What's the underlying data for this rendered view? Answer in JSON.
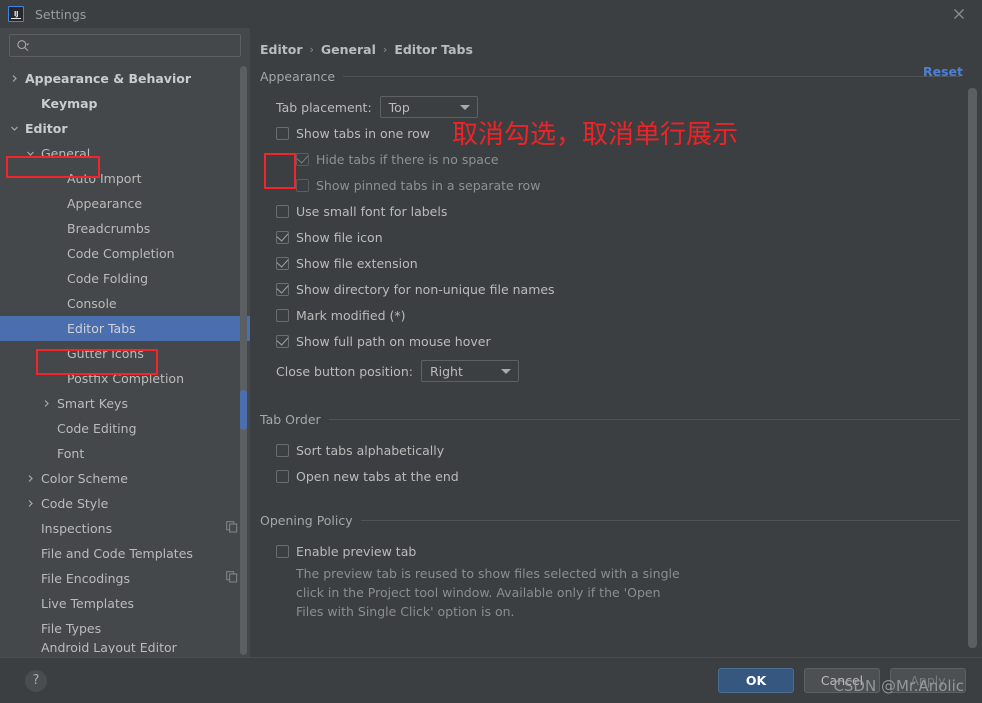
{
  "window": {
    "title": "Settings",
    "logo_text": "IJ",
    "close_icon": "close-icon"
  },
  "search": {
    "value": "",
    "placeholder": "",
    "icon": "search-icon"
  },
  "sidebar": {
    "items": [
      {
        "label": "Appearance & Behavior",
        "indent": 0,
        "twisty": "chevron-right",
        "bold": true,
        "selected": false,
        "trailing": ""
      },
      {
        "label": "Keymap",
        "indent": 1,
        "twisty": "",
        "bold": true,
        "selected": false,
        "trailing": ""
      },
      {
        "label": "Editor",
        "indent": 0,
        "twisty": "chevron-down",
        "bold": true,
        "selected": false,
        "trailing": ""
      },
      {
        "label": "General",
        "indent": 1,
        "twisty": "chevron-down",
        "bold": false,
        "selected": false,
        "trailing": ""
      },
      {
        "label": "Auto Import",
        "indent": 3,
        "twisty": "",
        "bold": false,
        "selected": false,
        "trailing": ""
      },
      {
        "label": "Appearance",
        "indent": 3,
        "twisty": "",
        "bold": false,
        "selected": false,
        "trailing": ""
      },
      {
        "label": "Breadcrumbs",
        "indent": 3,
        "twisty": "",
        "bold": false,
        "selected": false,
        "trailing": ""
      },
      {
        "label": "Code Completion",
        "indent": 3,
        "twisty": "",
        "bold": false,
        "selected": false,
        "trailing": ""
      },
      {
        "label": "Code Folding",
        "indent": 3,
        "twisty": "",
        "bold": false,
        "selected": false,
        "trailing": ""
      },
      {
        "label": "Console",
        "indent": 3,
        "twisty": "",
        "bold": false,
        "selected": false,
        "trailing": ""
      },
      {
        "label": "Editor Tabs",
        "indent": 3,
        "twisty": "",
        "bold": false,
        "selected": true,
        "trailing": ""
      },
      {
        "label": "Gutter Icons",
        "indent": 3,
        "twisty": "",
        "bold": false,
        "selected": false,
        "trailing": ""
      },
      {
        "label": "Postfix Completion",
        "indent": 3,
        "twisty": "",
        "bold": false,
        "selected": false,
        "trailing": ""
      },
      {
        "label": "Smart Keys",
        "indent": 2,
        "twisty": "chevron-right",
        "bold": false,
        "selected": false,
        "trailing": ""
      },
      {
        "label": "Code Editing",
        "indent": 2,
        "twisty": "",
        "bold": false,
        "selected": false,
        "trailing": ""
      },
      {
        "label": "Font",
        "indent": 2,
        "twisty": "",
        "bold": false,
        "selected": false,
        "trailing": ""
      },
      {
        "label": "Color Scheme",
        "indent": 1,
        "twisty": "chevron-right",
        "bold": false,
        "selected": false,
        "trailing": ""
      },
      {
        "label": "Code Style",
        "indent": 1,
        "twisty": "chevron-right",
        "bold": false,
        "selected": false,
        "trailing": ""
      },
      {
        "label": "Inspections",
        "indent": 1,
        "twisty": "",
        "bold": false,
        "selected": false,
        "trailing": "copy-icon"
      },
      {
        "label": "File and Code Templates",
        "indent": 1,
        "twisty": "",
        "bold": false,
        "selected": false,
        "trailing": ""
      },
      {
        "label": "File Encodings",
        "indent": 1,
        "twisty": "",
        "bold": false,
        "selected": false,
        "trailing": "copy-icon"
      },
      {
        "label": "Live Templates",
        "indent": 1,
        "twisty": "",
        "bold": false,
        "selected": false,
        "trailing": ""
      },
      {
        "label": "File Types",
        "indent": 1,
        "twisty": "",
        "bold": false,
        "selected": false,
        "trailing": ""
      },
      {
        "label": "Android Layout Editor",
        "indent": 1,
        "twisty": "",
        "bold": false,
        "selected": false,
        "trailing": ""
      }
    ]
  },
  "breadcrumb": {
    "items": [
      "Editor",
      "General",
      "Editor Tabs"
    ],
    "separator": "›"
  },
  "reset": {
    "label": "Reset"
  },
  "appearance_section": {
    "title": "Appearance",
    "tab_placement": {
      "label": "Tab placement:",
      "value": "Top"
    },
    "checkboxes": [
      {
        "label": "Show tabs in one row",
        "checked": false,
        "disabled": false,
        "indent": 1
      },
      {
        "label": "Hide tabs if there is no space",
        "checked": true,
        "disabled": true,
        "indent": 2
      },
      {
        "label": "Show pinned tabs in a separate row",
        "checked": false,
        "disabled": true,
        "indent": 2
      },
      {
        "label": "Use small font for labels",
        "checked": false,
        "disabled": false,
        "indent": 1
      },
      {
        "label": "Show file icon",
        "checked": true,
        "disabled": false,
        "indent": 1
      },
      {
        "label": "Show file extension",
        "checked": true,
        "disabled": false,
        "indent": 1
      },
      {
        "label": "Show directory for non-unique file names",
        "checked": true,
        "disabled": false,
        "indent": 1
      },
      {
        "label": "Mark modified (*)",
        "checked": false,
        "disabled": false,
        "indent": 1
      },
      {
        "label": "Show full path on mouse hover",
        "checked": true,
        "disabled": false,
        "indent": 1
      }
    ],
    "close_button_position": {
      "label": "Close button position:",
      "value": "Right"
    }
  },
  "tab_order_section": {
    "title": "Tab Order",
    "checkboxes": [
      {
        "label": "Sort tabs alphabetically",
        "checked": false
      },
      {
        "label": "Open new tabs at the end",
        "checked": false
      }
    ]
  },
  "opening_policy_section": {
    "title": "Opening Policy",
    "checkbox": {
      "label": "Enable preview tab",
      "checked": false
    },
    "description": "The preview tab is reused to show files selected with a single click in the Project tool window. Available only if the 'Open Files with Single Click' option is on."
  },
  "annotation": {
    "text": "取消勾选，取消单行展示",
    "color": "#ee2327"
  },
  "footer": {
    "help_label": "?",
    "ok_label": "OK",
    "cancel_label": "Cancel",
    "apply_label": "Apply"
  },
  "watermark": {
    "text": "CSDN @Mr.Anolic"
  },
  "colors": {
    "window_bg": "#3c3f41",
    "sidebar_bg": "#45484a",
    "selection": "#4b6eaf",
    "accent_link": "#4d80d4",
    "primary_button": "#365880",
    "annotation_red": "#ee2327",
    "text": "#bbbbbb"
  }
}
